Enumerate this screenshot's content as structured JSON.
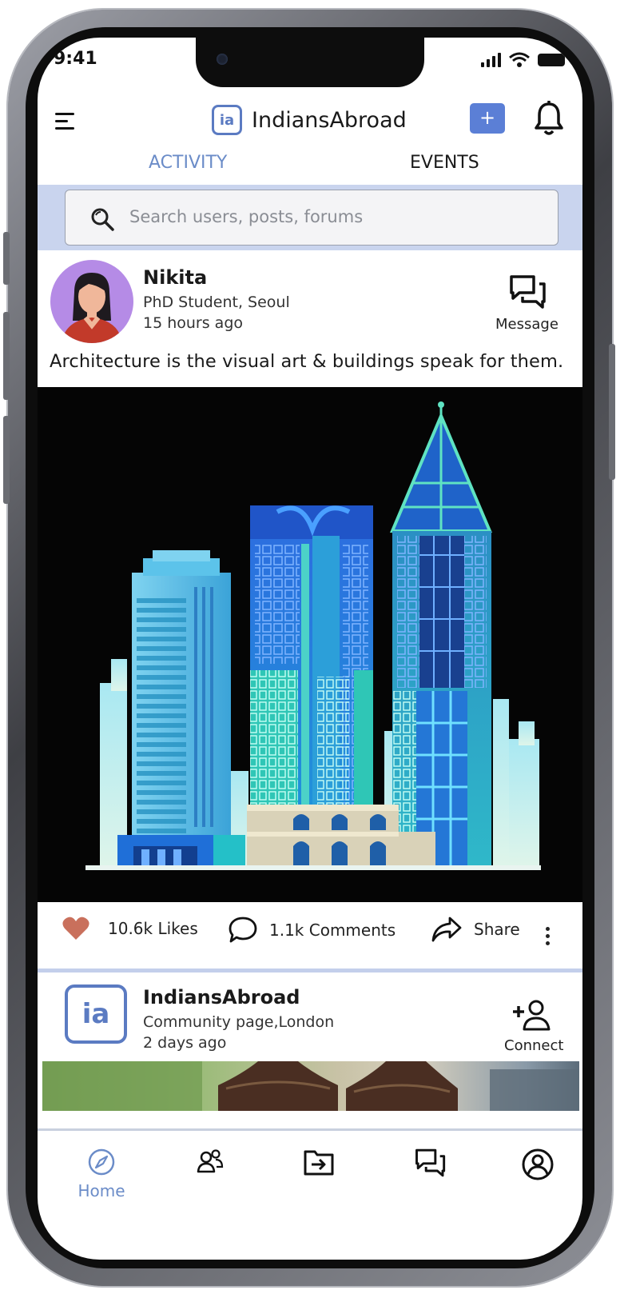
{
  "status_bar": {
    "time": "9:41"
  },
  "header": {
    "brand_name": "IndiansAbroad",
    "add_button_label": "+"
  },
  "tabs": [
    {
      "label": "ACTIVITY"
    },
    {
      "label": "EVENTS"
    }
  ],
  "search": {
    "placeholder": "Search users, posts, forums"
  },
  "post": {
    "author": "Nikita",
    "subtitle": "PhD Student, Seoul",
    "time": "15 hours ago",
    "message_label": "Message",
    "text": "Architecture is the visual art & buildings speak for them.",
    "likes": "10.6k Likes",
    "comments": "1.1k Comments",
    "share": "Share"
  },
  "post2": {
    "author": "IndiansAbroad",
    "subtitle": "Community page,London",
    "time": "2 days ago",
    "connect_label": "Connect"
  },
  "bottom_nav": {
    "home_label": "Home"
  },
  "colors": {
    "accent": "#6b8cc8",
    "button": "#5b7fd6",
    "search_band": "#c9d4ee",
    "heart": "#c9705c"
  }
}
